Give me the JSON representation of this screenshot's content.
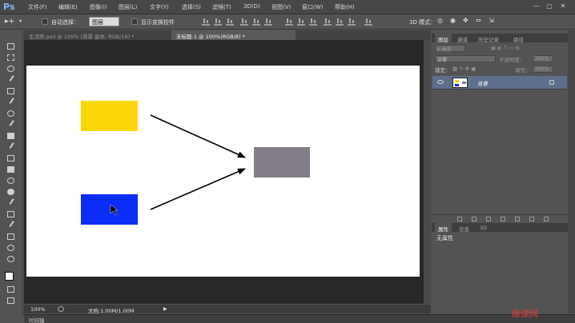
{
  "app": {
    "logo": "Ps"
  },
  "menu": [
    "文件(F)",
    "编辑(E)",
    "图像(I)",
    "图层(L)",
    "文字(Y)",
    "选择(S)",
    "滤镜(T)",
    "3D(D)",
    "视图(V)",
    "窗口(W)",
    "帮助(H)"
  ],
  "window_controls": {
    "minimize": "—",
    "maximize": "▢",
    "close": "✕"
  },
  "options": {
    "auto_select_label": "自动选择：",
    "auto_select_value": "图层",
    "show_transform_label": "显示变换控件",
    "mode_3d_label": "3D 模式："
  },
  "doc_tabs": [
    {
      "label": "生活照.psd @ 100% (背景 副本, RGB/16) *",
      "active": false
    },
    {
      "label": "未标题-1 @ 100%(RGB/8) *",
      "active": true
    }
  ],
  "canvas": {
    "background": "#ffffff",
    "shapes": {
      "yellow": "#fcd80a",
      "blue": "#0c2cf7",
      "gray": "#837d87"
    }
  },
  "status": {
    "zoom": "100%",
    "doc_info": "文档:1.00M/1.00M"
  },
  "timeline_label": "时间轴",
  "layers_panel": {
    "tabs": [
      "图层",
      "通道",
      "历史记录",
      "路径"
    ],
    "kind_label": "ρ 类型",
    "blend_mode": "正常",
    "opacity_label": "不透明度：",
    "opacity_value": "100%",
    "lock_label": "锁定：",
    "fill_label": "填充：",
    "fill_value": "100%",
    "layers": [
      {
        "name": "背景"
      }
    ]
  },
  "properties_panel": {
    "tabs": [
      "属性",
      "信息",
      "3D"
    ],
    "empty_text": "无属性"
  },
  "watermark": "缘课网"
}
